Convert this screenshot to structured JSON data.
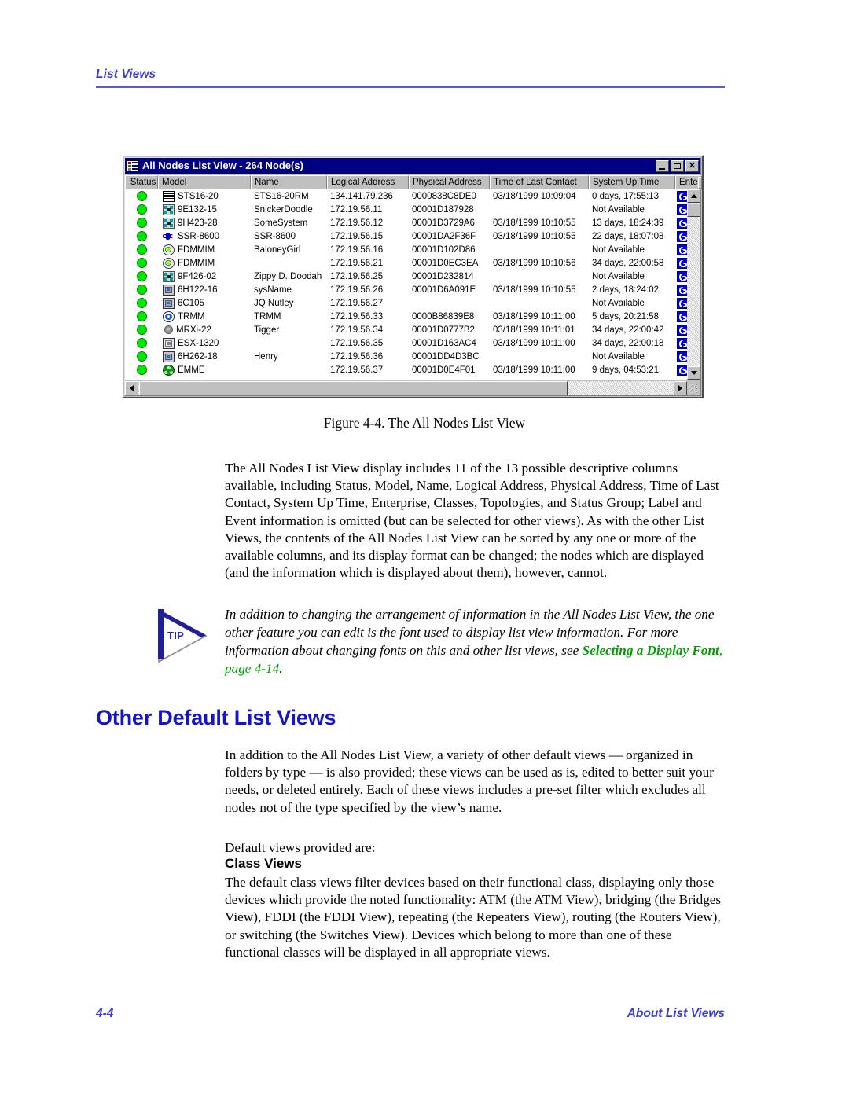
{
  "page": {
    "header_text": "List Views",
    "footer_page_number": "4-4",
    "footer_section": "About List Views"
  },
  "figure": {
    "caption": "Figure 4-4.  The All Nodes List View",
    "window": {
      "title": "All Nodes List View - 264 Node(s)",
      "title_icon": "list-view-icon",
      "minimize_label": "_",
      "maximize_label": "□",
      "close_label": "✕",
      "columns": [
        "Status",
        "Model",
        "Name",
        "Logical Address",
        "Physical Address",
        "Time of Last Contact",
        "System Up Time",
        "Ente"
      ],
      "sort_indicator": "ascending",
      "rows": [
        {
          "status": "up",
          "icon": "chassis-icon",
          "model": "STS16-20",
          "name": "STS16-20RM",
          "logical": "134.141.79.236",
          "physical": "0000838C8DE0",
          "contact": "03/18/1999 10:09:04",
          "uptime": "0 days, 17:55:13",
          "enterprise": "cabletron-icon"
        },
        {
          "status": "up",
          "icon": "switch-icon",
          "model": "9E132-15",
          "name": "SnickerDoodle",
          "logical": "172.19.56.11",
          "physical": "00001D187928",
          "contact": "",
          "uptime": "Not Available",
          "enterprise": "cabletron-icon"
        },
        {
          "status": "up",
          "icon": "switch-icon",
          "model": "9H423-28",
          "name": "SomeSystem",
          "logical": "172.19.56.12",
          "physical": "00001D3729A6",
          "contact": "03/18/1999 10:10:55",
          "uptime": "13 days, 18:24:39",
          "enterprise": "cabletron-icon"
        },
        {
          "status": "up",
          "icon": "router-icon",
          "model": "SSR-8600",
          "name": "SSR-8600",
          "logical": "172.19.56.15",
          "physical": "00001DA2F36F",
          "contact": "03/18/1999 10:10:55",
          "uptime": "22 days, 18:07:08",
          "enterprise": "cabletron-icon"
        },
        {
          "status": "up",
          "icon": "fddi-ring-icon",
          "model": "FDMMIM",
          "name": "BaloneyGirl",
          "logical": "172.19.56.16",
          "physical": "00001D102D86",
          "contact": "",
          "uptime": "Not Available",
          "enterprise": "cabletron-icon"
        },
        {
          "status": "up",
          "icon": "fddi-ring-icon",
          "model": "FDMMIM",
          "name": "",
          "logical": "172.19.56.21",
          "physical": "00001D0EC3EA",
          "contact": "03/18/1999 10:10:56",
          "uptime": "34 days, 22:00:58",
          "enterprise": "cabletron-icon"
        },
        {
          "status": "up",
          "icon": "switch-icon",
          "model": "9F426-02",
          "name": "Zippy D. Doodah",
          "logical": "172.19.56.25",
          "physical": "00001D232814",
          "contact": "",
          "uptime": "Not Available",
          "enterprise": "cabletron-icon"
        },
        {
          "status": "up",
          "icon": "device-box-icon",
          "model": "6H122-16",
          "name": "sysName",
          "logical": "172.19.56.26",
          "physical": "00001D6A091E",
          "contact": "03/18/1999 10:10:55",
          "uptime": "2 days, 18:24:02",
          "enterprise": "cabletron-icon"
        },
        {
          "status": "up",
          "icon": "device-box-icon",
          "model": "6C105",
          "name": "JQ Nutley",
          "logical": "172.19.56.27",
          "physical": "",
          "contact": "",
          "uptime": "Not Available",
          "enterprise": "cabletron-icon"
        },
        {
          "status": "up",
          "icon": "token-ring-icon",
          "model": "TRMM",
          "name": "TRMM",
          "logical": "172.19.56.33",
          "physical": "0000B86839E8",
          "contact": "03/18/1999 10:11:00",
          "uptime": "5 days, 20:21:58",
          "enterprise": "cabletron-icon"
        },
        {
          "status": "up",
          "icon": "sphere-icon",
          "model": "MRXi-22",
          "name": "Tigger",
          "logical": "172.19.56.34",
          "physical": "00001D0777B2",
          "contact": "03/18/1999 10:11:01",
          "uptime": "34 days, 22:00:42",
          "enterprise": "cabletron-icon"
        },
        {
          "status": "up",
          "icon": "esx-chassis-icon",
          "model": "ESX-1320",
          "name": "",
          "logical": "172.19.56.35",
          "physical": "00001D163AC4",
          "contact": "03/18/1999 10:11:00",
          "uptime": "34 days, 22:00:18",
          "enterprise": "cabletron-icon"
        },
        {
          "status": "up",
          "icon": "device-box-icon",
          "model": "6H262-18",
          "name": "Henry",
          "logical": "172.19.56.36",
          "physical": "00001DD4D3BC",
          "contact": "",
          "uptime": "Not Available",
          "enterprise": "cabletron-icon"
        },
        {
          "status": "up",
          "icon": "emme-hub-icon",
          "model": "EMME",
          "name": "",
          "logical": "172.19.56.37",
          "physical": "00001D0E4F01",
          "contact": "03/18/1999 10:11:00",
          "uptime": "9 days, 04:53:21",
          "enterprise": "cabletron-icon"
        }
      ]
    }
  },
  "content": {
    "paragraph_1": "The All Nodes List View display includes 11 of the 13 possible descriptive columns available, including Status, Model, Name, Logical Address, Physical Address, Time of Last Contact, System Up Time, Enterprise, Classes, Topologies, and Status Group; Label and Event information is omitted (but can be selected for other views). As with the other List Views, the contents of the All Nodes List View can be sorted by any one or more of the available columns, and its display format can be changed; the nodes which are displayed (and the information which is displayed about them), however, cannot.",
    "tip": {
      "badge_label": "TIP",
      "text_before": "In addition to changing the arrangement of information in the All Nodes List View, the one other feature you can edit is the font used to display list view information. For more information about changing fonts on this and other list views, see ",
      "link_text": "Selecting a Display Font",
      "link_page": ", page 4-14",
      "text_after": "."
    },
    "heading_1": "Other Default List Views",
    "paragraph_2": "In addition to the All Nodes List View, a variety of other default views — organized in folders by type — is also provided; these views can be used as is, edited to better suit your needs, or deleted entirely. Each of these views includes a pre-set filter which excludes all nodes not of the type specified by the view’s name.",
    "paragraph_3": "Default views provided are:",
    "heading_2": "Class Views",
    "paragraph_4": "The default class views filter devices based on their functional class, displaying only those devices which provide the noted functionality: ATM (the ATM View), bridging (the Bridges View), FDDI (the FDDI View), repeating (the Repeaters View), routing (the Routers View), or switching (the Switches View). Devices which belong to more than one of these functional classes will be displayed in all appropriate views."
  },
  "colors": {
    "header_blue": "#3b3bd4",
    "heading_blue": "#1414c8",
    "link_green": "#00a000",
    "titlebar_blue": "#000082",
    "status_green": "#00e800",
    "enterprise_icon_blue": "#0000e0"
  }
}
